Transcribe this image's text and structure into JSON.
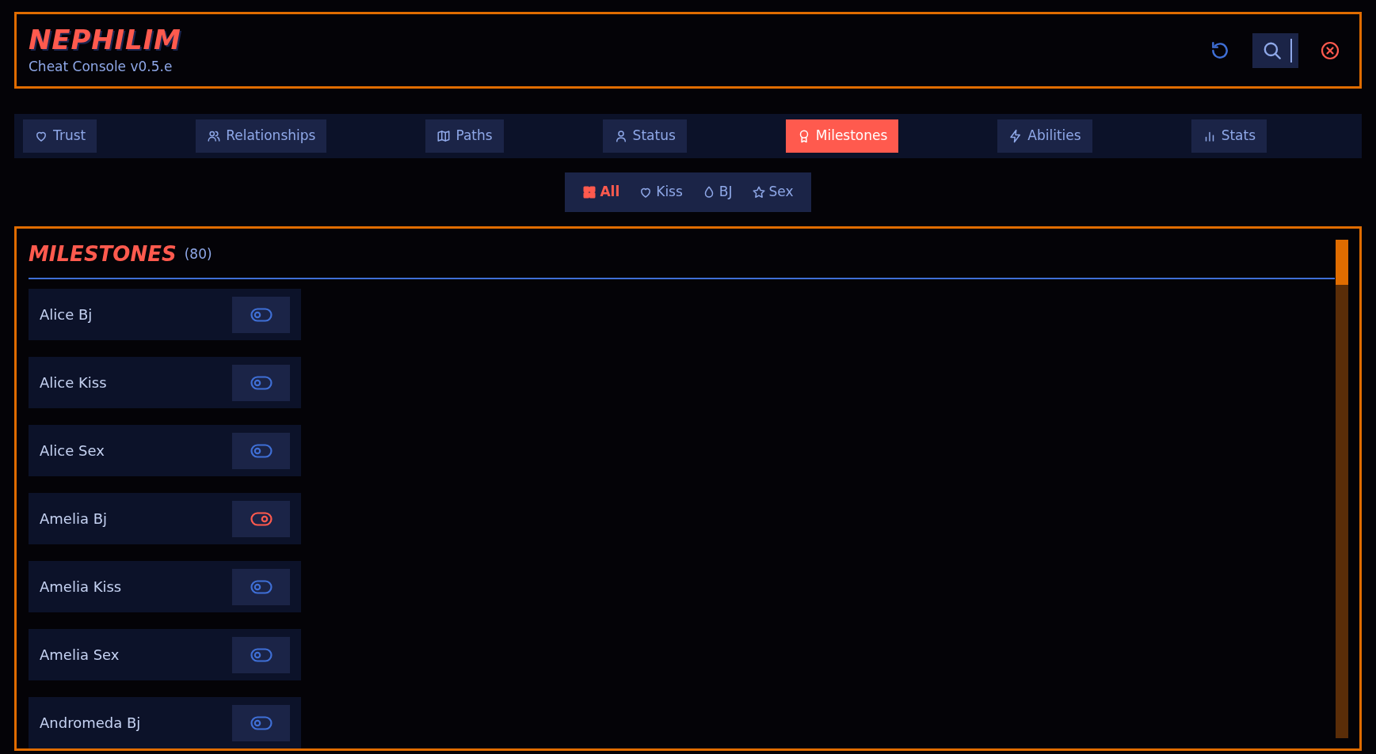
{
  "header": {
    "logo": "NEPHILIM",
    "subtitle": "Cheat Console v0.5.e"
  },
  "tabs": [
    {
      "label": "Trust",
      "selected": false
    },
    {
      "label": "Relationships",
      "selected": false
    },
    {
      "label": "Paths",
      "selected": false
    },
    {
      "label": "Status",
      "selected": false
    },
    {
      "label": "Milestones",
      "selected": true
    },
    {
      "label": "Abilities",
      "selected": false
    },
    {
      "label": "Stats",
      "selected": false
    }
  ],
  "filters": [
    {
      "label": "All",
      "selected": true
    },
    {
      "label": "Kiss",
      "selected": false
    },
    {
      "label": "BJ",
      "selected": false
    },
    {
      "label": "Sex",
      "selected": false
    }
  ],
  "panel": {
    "title": "MILESTONES",
    "count": "(80)",
    "items": [
      {
        "name": "Alice Bj",
        "on": false
      },
      {
        "name": "Alice Kiss",
        "on": false
      },
      {
        "name": "Alice Sex",
        "on": false
      },
      {
        "name": "Amelia Bj",
        "on": true
      },
      {
        "name": "Amelia Kiss",
        "on": false
      },
      {
        "name": "Amelia Sex",
        "on": false
      },
      {
        "name": "Andromeda Bj",
        "on": false
      }
    ]
  }
}
